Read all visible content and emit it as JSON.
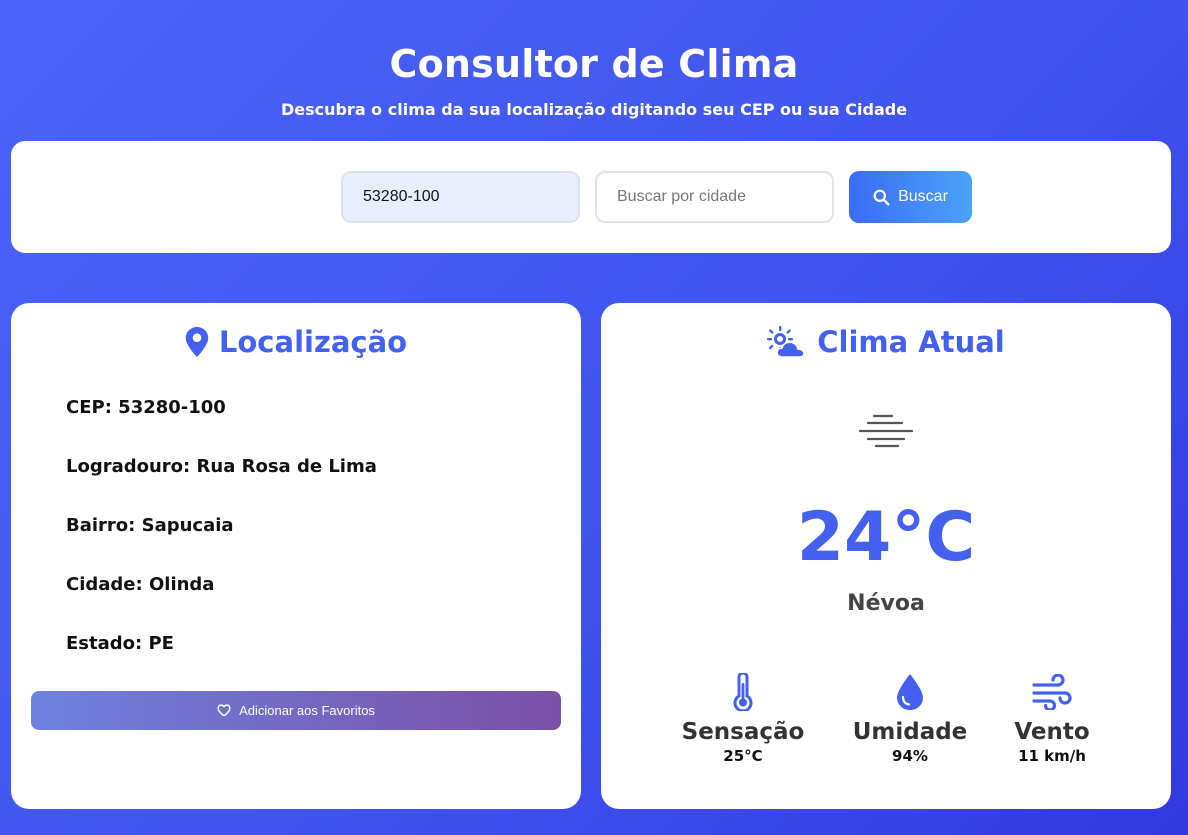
{
  "header": {
    "title": "Consultor de Clima",
    "subtitle": "Descubra o clima da sua localização digitando seu CEP ou sua Cidade"
  },
  "search": {
    "cep_value": "53280-100",
    "city_placeholder": "Buscar por cidade",
    "button_label": "Buscar"
  },
  "location": {
    "heading": "Localização",
    "rows": [
      "CEP: 53280-100",
      "Logradouro: Rua Rosa de Lima",
      "Bairro: Sapucaia",
      "Cidade: Olinda",
      "Estado: PE"
    ],
    "favorite_label": "Adicionar aos Favoritos"
  },
  "weather": {
    "heading": "Clima Atual",
    "icon": "fog-icon",
    "temperature": "24°C",
    "description": "Névoa",
    "stats": [
      {
        "icon": "thermometer-icon",
        "label": "Sensação",
        "value": "25°C"
      },
      {
        "icon": "droplet-icon",
        "label": "Umidade",
        "value": "94%"
      },
      {
        "icon": "wind-icon",
        "label": "Vento",
        "value": "11 km/h"
      }
    ]
  },
  "colors": {
    "accent": "#4361ee",
    "background": "#4b63f6",
    "button_start": "#3b6cf5",
    "button_end": "#4aa3f6",
    "favorite_start": "#6d82df",
    "favorite_end": "#7b4fa6"
  }
}
